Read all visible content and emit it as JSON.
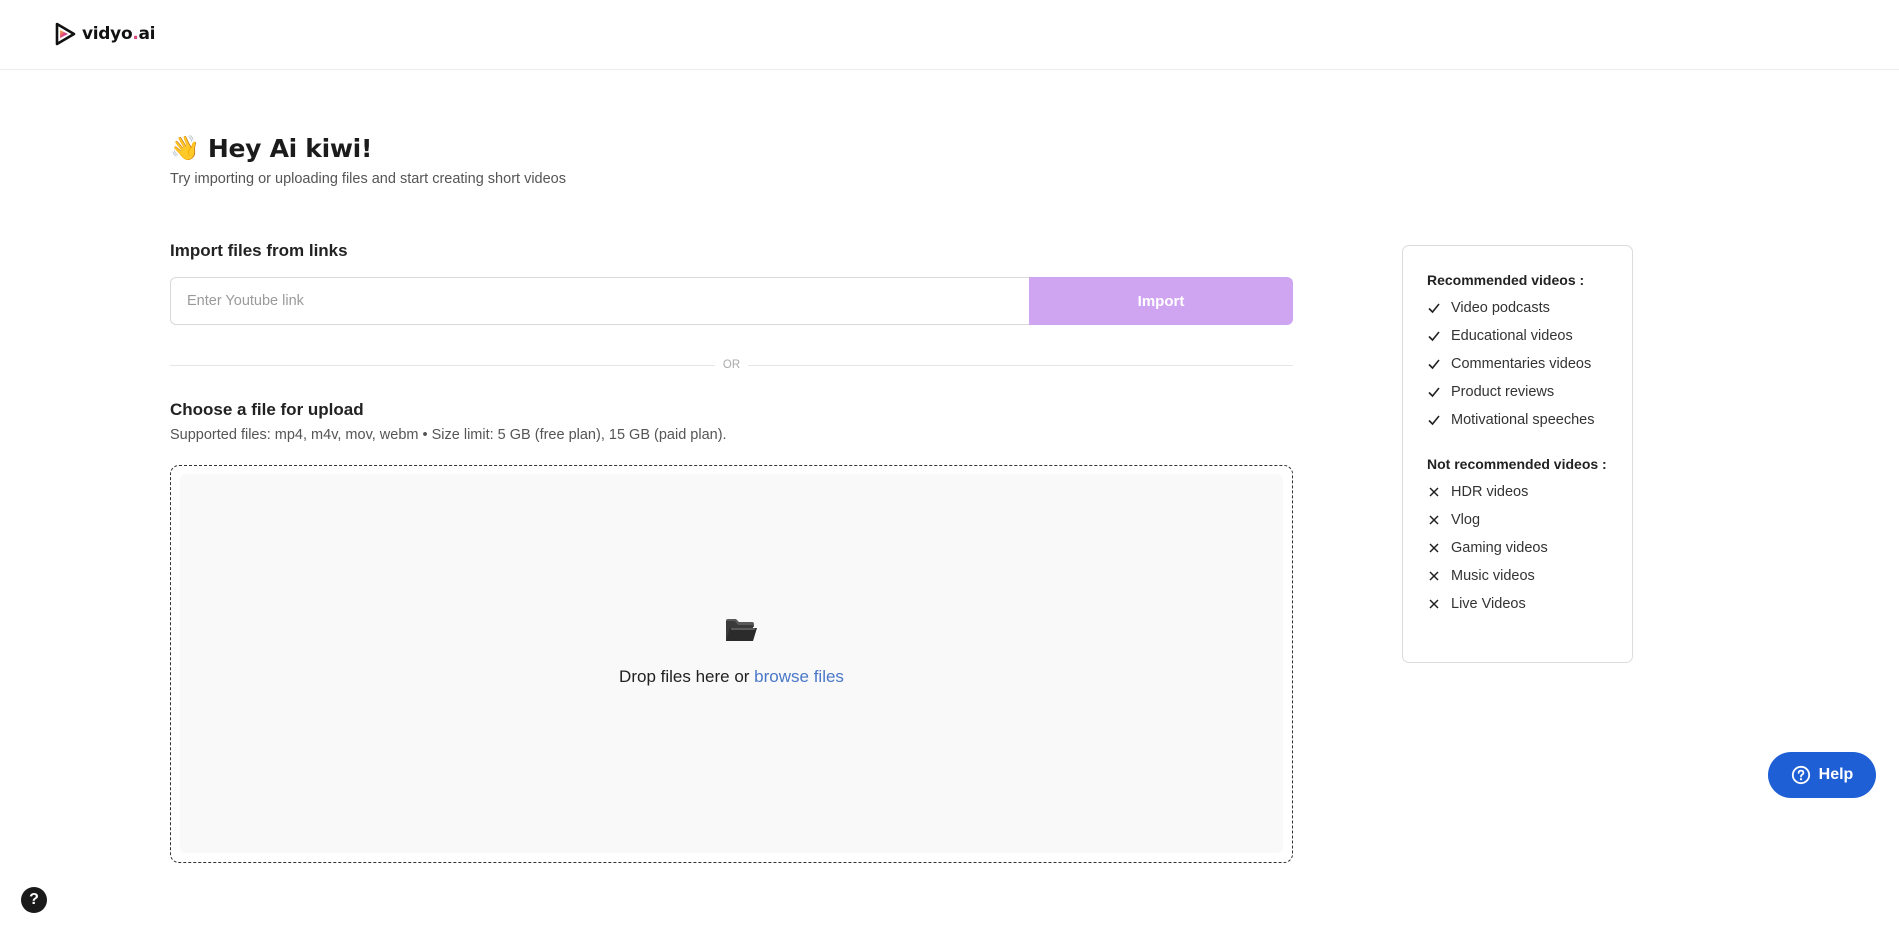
{
  "app": {
    "logo_text_main": "vidyo",
    "logo_text_dot": ".",
    "logo_text_tld": "ai"
  },
  "greeting": {
    "emoji": "👋",
    "title": "Hey Ai kiwi!",
    "subtitle": "Try importing or uploading files and start creating short videos"
  },
  "import": {
    "title": "Import files from links",
    "placeholder": "Enter Youtube link",
    "value": "",
    "button_label": "Import"
  },
  "divider": {
    "label": "OR"
  },
  "upload": {
    "title": "Choose a file for upload",
    "supported": "Supported files: mp4, m4v, mov, webm • Size limit: 5 GB (free plan), 15 GB (paid plan).",
    "drop_text": "Drop files here or ",
    "browse_label": "browse files",
    "icon": "open-folder-icon"
  },
  "sidebar": {
    "recommended_title": "Recommended videos :",
    "recommended": [
      "Video podcasts",
      "Educational videos",
      "Commentaries videos",
      "Product reviews",
      "Motivational speeches"
    ],
    "not_recommended_title": "Not recommended videos :",
    "not_recommended": [
      "HDR videos",
      "Vlog",
      "Gaming videos",
      "Music videos",
      "Live Videos"
    ]
  },
  "help": {
    "label": "Help",
    "corner_label": "?"
  },
  "colors": {
    "import_button": "#cfa5f2",
    "help_button": "#1f5fd6",
    "link": "#4a78c9"
  }
}
